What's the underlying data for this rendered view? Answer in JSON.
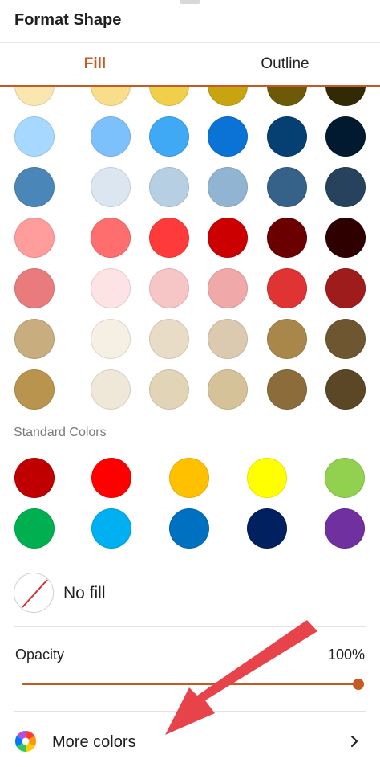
{
  "header": {
    "title": "Format Shape"
  },
  "tabs": {
    "fill": "Fill",
    "outline": "Outline"
  },
  "accent_color": "#c55a24",
  "theme_palette": [
    [
      "#fae7b0",
      "#f8dd8a",
      "#f0cf4a",
      "#c8a411",
      "#6c5a08",
      "#322a04"
    ],
    [
      "#a7d8ff",
      "#7dc1fc",
      "#3fa9f5",
      "#0b73d6",
      "#063f72",
      "#021a2f"
    ],
    [
      "#4a86b8",
      "#dce6f0",
      "#b7cfe3",
      "#92b4d3",
      "#366189",
      "#26425c"
    ],
    [
      "#ff9c9c",
      "#ff6e6e",
      "#ff3a3a",
      "#cc0000",
      "#6b0000",
      "#2f0000"
    ],
    [
      "#e97b7c",
      "#fde3e4",
      "#f6c5c6",
      "#f0a8a9",
      "#e03333",
      "#9e1c1c"
    ],
    [
      "#c8ad7e",
      "#f5efe4",
      "#e8dcc7",
      "#dccab0",
      "#a9874b",
      "#6e5631"
    ],
    [
      "#b8944f",
      "#efe8d8",
      "#e2d4b6",
      "#d6c299",
      "#8b6c3a",
      "#5b4625"
    ]
  ],
  "standard_colors": {
    "label": "Standard Colors",
    "rows": [
      [
        "#c00000",
        "#ff0000",
        "#ffc000",
        "#ffff00",
        "#92d050"
      ],
      [
        "#00b050",
        "#00b0f0",
        "#0070c0",
        "#002060",
        "#7030a0"
      ]
    ]
  },
  "no_fill": {
    "label": "No fill"
  },
  "opacity": {
    "label": "Opacity",
    "value_text": "100%",
    "value": 1.0
  },
  "more_colors": {
    "label": "More colors"
  }
}
